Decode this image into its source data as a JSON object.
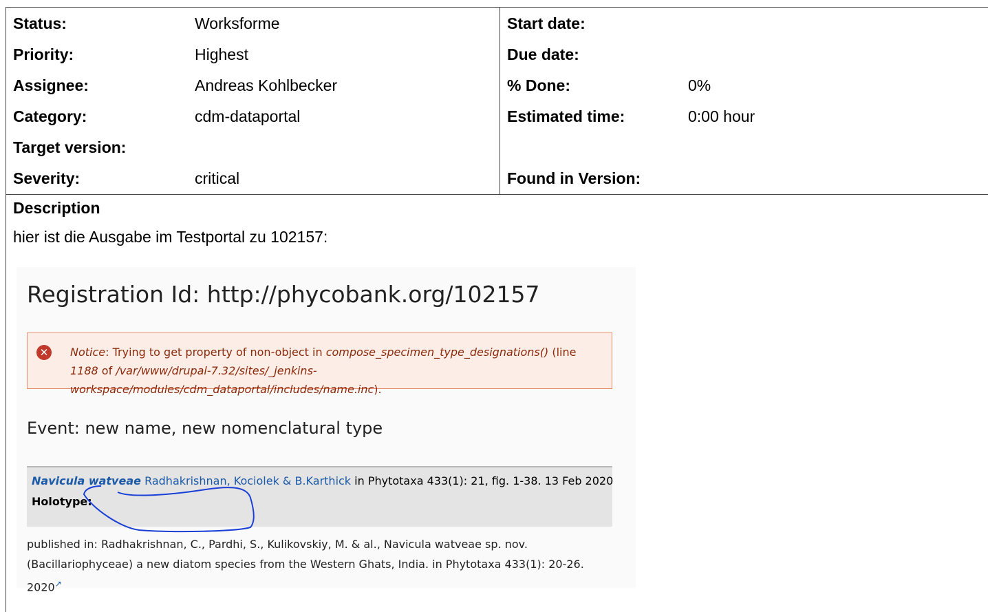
{
  "attributes": {
    "left": [
      {
        "label": "Status:",
        "value": "Worksforme"
      },
      {
        "label": "Priority:",
        "value": "Highest"
      },
      {
        "label": "Assignee:",
        "value": "Andreas Kohlbecker"
      },
      {
        "label": "Category:",
        "value": "cdm-dataportal"
      },
      {
        "label": "Target version:",
        "value": ""
      },
      {
        "label": "Severity:",
        "value": "critical"
      }
    ],
    "right": [
      {
        "label": "Start date:",
        "value": ""
      },
      {
        "label": "Due date:",
        "value": ""
      },
      {
        "label": "% Done:",
        "value": "0%"
      },
      {
        "label": "Estimated time:",
        "value": "0:00 hour"
      },
      {
        "label": "",
        "value": ""
      },
      {
        "label": "Found in Version:",
        "value": ""
      }
    ]
  },
  "description": {
    "title": "Description",
    "text": "hier ist die Ausgabe im Testportal zu 102157:"
  },
  "screenshot": {
    "title": "Registration Id: http://phycobank.org/102157",
    "notice": {
      "label": "Notice",
      "sep1": ": Trying to get property of non-object in ",
      "function": "compose_specimen_type_designations()",
      "sep2": " (line ",
      "line": "1188",
      "sep3": " of ",
      "path": "/var/www/drupal-7.32/sites/_jenkins-workspace/modules/cdm_dataportal/includes/name.inc",
      "sep4": ")."
    },
    "event": "Event: new name, new nomenclatural type",
    "name": {
      "taxon": "Navicula watveae",
      "authors": "Radhakrishnan, Kociolek & B.Karthick",
      "publication": " in Phytotaxa 433(1): 21, fig. 1-38. 13 Feb 2020",
      "holotype": "Holotype:"
    },
    "published": "published in: Radhakrishnan, C., Pardhi, S., Kulikovskiy, M. & al., Navicula watveae sp. nov. (Bacillariophyceae) a new diatom species from the Western Ghats, India. in Phytotaxa 433(1): 20-26. 2020",
    "external_link_icon": "external-link-icon"
  },
  "colors": {
    "link": "#1c5aa7",
    "notice_bg": "#fcede6",
    "notice_border": "#e88f6e",
    "error_icon": "#c0392b",
    "scribble": "#1a3fd6"
  }
}
